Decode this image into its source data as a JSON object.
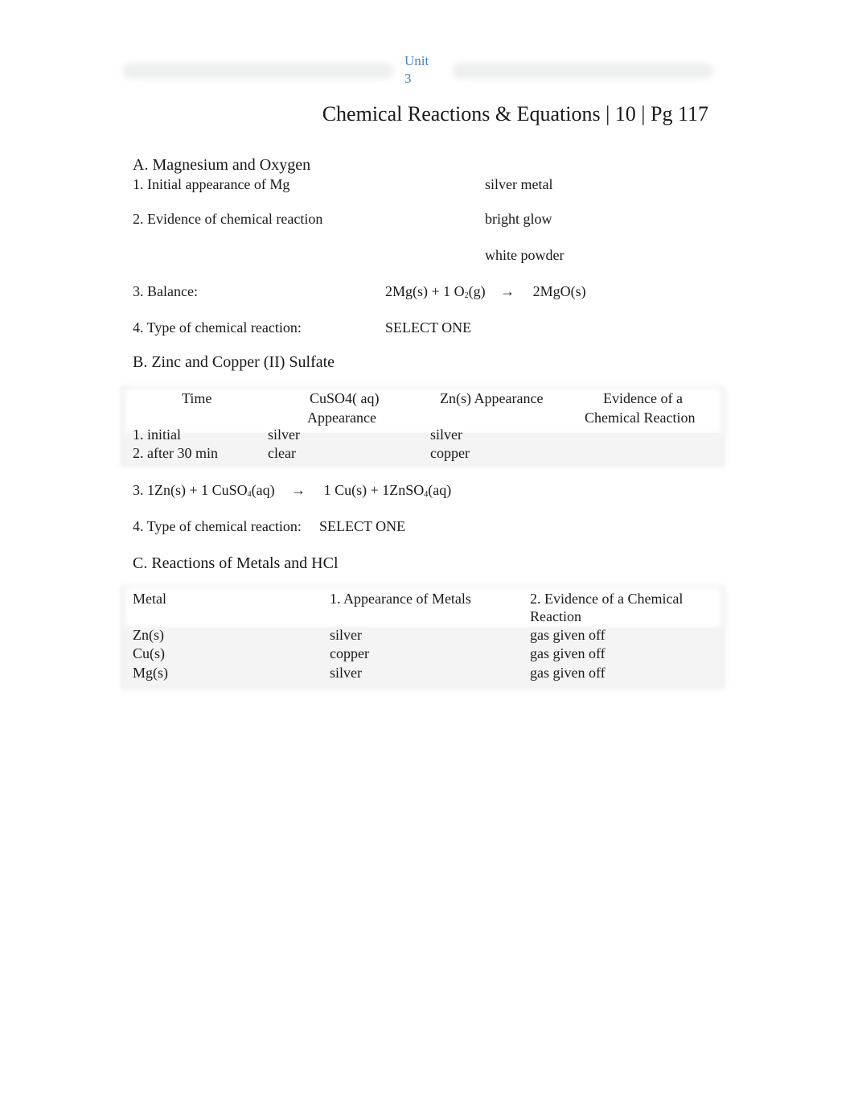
{
  "header": {
    "unit_label": "Unit",
    "unit_number": "3",
    "title": "Chemical Reactions & Equations | 10 | Pg 117"
  },
  "section_a": {
    "heading": "A. Magnesium and Oxygen",
    "q1_label": "1.  Initial appearance of Mg",
    "q1_answer": "silver metal",
    "q2_label": "2.  Evidence of chemical reaction",
    "q2_answers": [
      "bright glow",
      "white powder"
    ],
    "q3_label": "3.  Balance:",
    "q3_equation": {
      "left_a": "2Mg(s) + 1 O",
      "left_sub": "2",
      "left_b": "(g)",
      "arrow": "→",
      "right": "2MgO(s)"
    },
    "q4_label": "4.  Type of chemical reaction:",
    "q4_answer": "SELECT ONE"
  },
  "section_b": {
    "heading": "B.  Zinc and Copper (II) Sulfate",
    "table": {
      "headers": [
        "Time",
        "CuSO4( aq)",
        "Appearance",
        "Zn(s) Appearance",
        "Evidence of a",
        "Chemical Reaction"
      ],
      "rows": [
        [
          "1. initial",
          "silver",
          "silver",
          ""
        ],
        [
          "2. after 30 min",
          "clear",
          "copper",
          ""
        ]
      ]
    },
    "q3_equation": {
      "prefix": "3. 1Zn(s) + 1 CuSO",
      "sub1": "4",
      "mid": "(aq)",
      "arrow": "→",
      "right_a": "1 Cu(s) + 1ZnSO",
      "sub2": "4",
      "right_b": "(aq)"
    },
    "q4_label": "4. Type of chemical reaction:",
    "q4_answer": "SELECT ONE"
  },
  "section_c": {
    "heading": "C.  Reactions of Metals and HCl",
    "table": {
      "headers": [
        "Metal",
        "1.  Appearance of Metals",
        "2.  Evidence of a Chemical",
        "Reaction"
      ],
      "rows": [
        [
          "Zn(s)",
          "silver",
          "gas given off"
        ],
        [
          "Cu(s)",
          "copper",
          "gas given off"
        ],
        [
          "Mg(s)",
          "silver",
          "gas given off"
        ]
      ]
    }
  }
}
